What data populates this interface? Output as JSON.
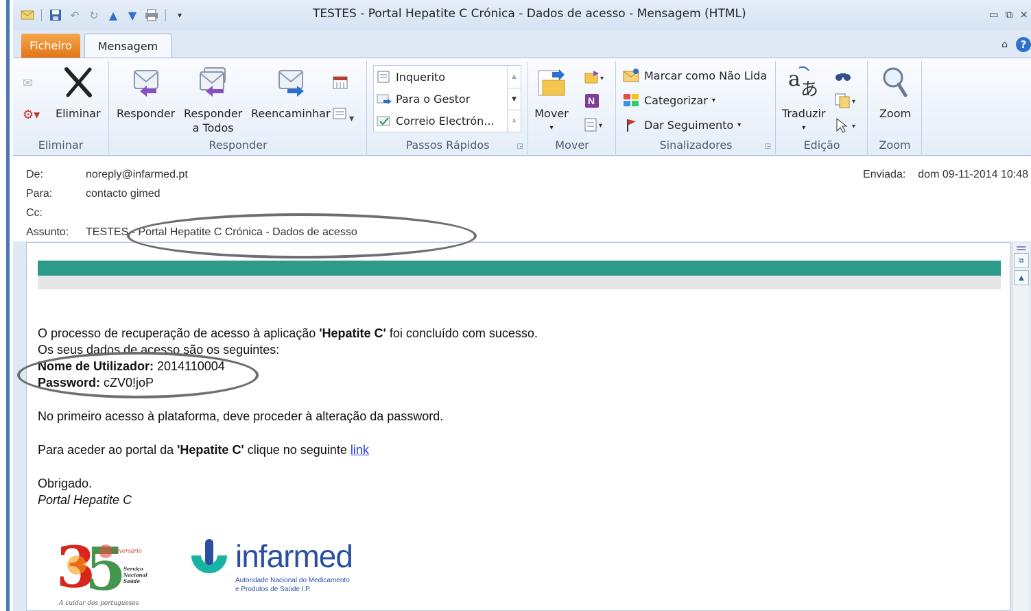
{
  "window": {
    "title": "TESTES - Portal Hepatite C Crónica - Dados de acesso  -  Mensagem (HTML)",
    "qat_icons": [
      "mail-icon",
      "save-icon",
      "undo-icon",
      "redo-icon",
      "up-arrow-icon",
      "down-arrow-icon",
      "print-icon",
      "customize-icon"
    ],
    "controls": [
      "minimize-icon",
      "restore-icon",
      "close-icon"
    ]
  },
  "tabs": {
    "file": "Ficheiro",
    "message": "Mensagem"
  },
  "ribbon": {
    "groups": {
      "eliminar": {
        "label": "Eliminar",
        "delete": "Eliminar"
      },
      "responder": {
        "label": "Responder",
        "reply": "Responder",
        "reply_all_1": "Responder",
        "reply_all_2": "a Todos",
        "forward": "Reencaminhar"
      },
      "passos": {
        "label": "Passos Rápidos",
        "items": [
          "Inquerito",
          "Para o Gestor",
          "Correio Electrón..."
        ]
      },
      "mover": {
        "label": "Mover",
        "move": "Mover"
      },
      "sinalizadores": {
        "label": "Sinalizadores",
        "mark_unread": "Marcar como Não Lida",
        "categorize": "Categorizar",
        "follow_up": "Dar Seguimento"
      },
      "edicao": {
        "label": "Edição",
        "translate": "Traduzir"
      },
      "zoom": {
        "label": "Zoom",
        "zoom": "Zoom"
      }
    }
  },
  "header": {
    "from_label": "De:",
    "from": "noreply@infarmed.pt",
    "to_label": "Para:",
    "to": "contacto gimed",
    "cc_label": "Cc:",
    "cc": "",
    "subject_label": "Assunto:",
    "subject": "TESTES - Portal Hepatite C Crónica - Dados de acesso",
    "sent_label": "Enviada:",
    "sent": "dom 09-11-2014 10:48"
  },
  "body": {
    "line1_a": "O processo de recuperação de acesso à aplicação ",
    "line1_b": "'Hepatite C'",
    "line1_c": " foi concluído com sucesso.",
    "line2": "Os seus dados de acesso são os seguintes:",
    "user_label": "Nome de Utilizador:",
    "user_value": " 2014110004",
    "pass_label": "Password:",
    "pass_value": " cZV0!joP",
    "line5": "No primeiro acesso à plataforma, deve proceder à alteração da password.",
    "line6_a": "Para aceder ao portal da ",
    "line6_b": "'Hepatite C'",
    "line6_c": " clique no seguinte ",
    "line6_link": "link",
    "thanks": "Obrigado.",
    "signature": "Portal Hepatite C"
  },
  "logos": {
    "sns": {
      "caption": "A cuidar dos portugueses",
      "anniversary": "Aniversário",
      "service_1": "Serviço",
      "service_2": "Nacional",
      "service_3": "Saúde"
    },
    "infarmed": {
      "name": "infarmed",
      "sub_1": "Autoridade Nacional do Medicamento",
      "sub_2": "e Produtos de Saúde I.P."
    }
  },
  "colors": {
    "teal_bar": "#2e9a8a",
    "file_tab": "#e27515",
    "link": "#1f3ce6",
    "infarmed_blue": "#2a4fa0",
    "infarmed_teal": "#19b3a3"
  }
}
